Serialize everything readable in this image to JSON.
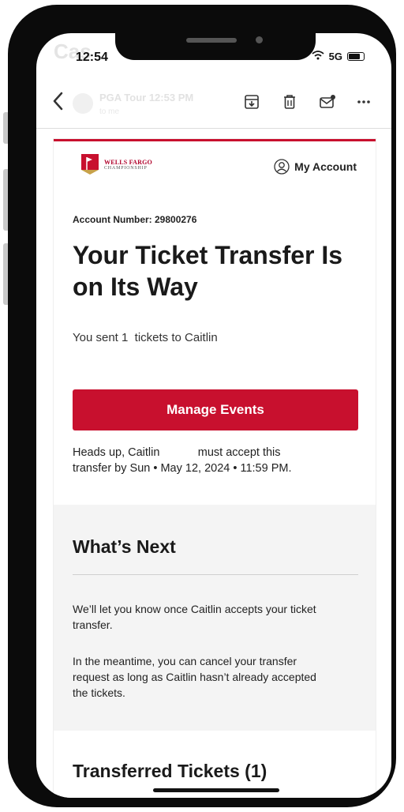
{
  "status_bar": {
    "time": "12:54",
    "network": "5G",
    "faded_text": "Cas"
  },
  "mail_header": {
    "sender_ghost": "PGA Tour  12:53 PM",
    "recipient_ghost": "to me"
  },
  "email": {
    "brand": {
      "line1": "WELLS FARGO",
      "line2": "CHAMPIONSHIP"
    },
    "my_account": "My Account",
    "account_number": "Account Number: 29800276",
    "headline": "Your Ticket Transfer Is on Its Way",
    "sent_text": "You sent 1  tickets to Caitlin",
    "manage_button": "Manage Events",
    "heads_up": "Heads up, Caitlin            must accept this\ntransfer by Sun • May 12, 2024 • 11:59 PM.",
    "whats_next": {
      "title": "What’s Next",
      "paragraph1": "We’ll let you know once Caitlin accepts your ticket transfer.",
      "paragraph2": "In the meantime, you can cancel your transfer request as long as Caitlin hasn’t already accepted the tickets."
    },
    "transferred_title": "Transferred Tickets (1)"
  },
  "colors": {
    "brand_red": "#c8102e",
    "bezel": "#0b0b0b",
    "panel_bg": "#f4f4f4"
  }
}
